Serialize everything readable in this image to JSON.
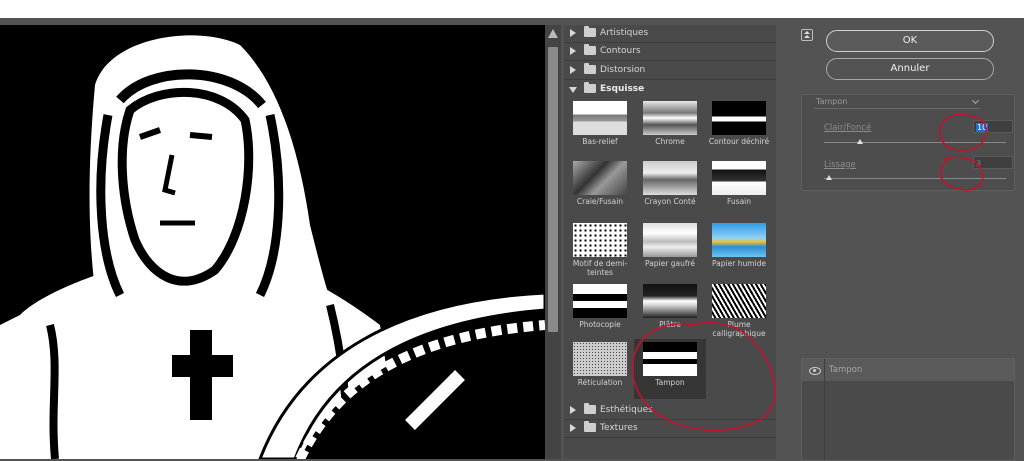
{
  "gallery": {
    "categories_top": [
      {
        "label": "Artistiques",
        "expanded": false
      },
      {
        "label": "Contours",
        "expanded": false
      },
      {
        "label": "Distorsion",
        "expanded": false
      },
      {
        "label": "Esquisse",
        "expanded": true
      }
    ],
    "filters": [
      {
        "label": "Bas-relief",
        "selected": false
      },
      {
        "label": "Chrome",
        "selected": false
      },
      {
        "label": "Contour déchiré",
        "selected": false
      },
      {
        "label": "Craie/Fusain",
        "selected": false
      },
      {
        "label": "Crayon Conté",
        "selected": false
      },
      {
        "label": "Fusain",
        "selected": false
      },
      {
        "label": "Motif de demi-teintes",
        "selected": false
      },
      {
        "label": "Papier gaufré",
        "selected": false
      },
      {
        "label": "Papier humide",
        "selected": false
      },
      {
        "label": "Photocopie",
        "selected": false
      },
      {
        "label": "Plâtre",
        "selected": false
      },
      {
        "label": "Plume calligraphique",
        "selected": false
      },
      {
        "label": "Réticulation",
        "selected": false
      },
      {
        "label": "Tampon",
        "selected": true
      }
    ],
    "categories_bottom": [
      {
        "label": "Esthétiques",
        "expanded": false
      },
      {
        "label": "Textures",
        "expanded": false
      }
    ]
  },
  "dialog": {
    "ok_label": "OK",
    "cancel_label": "Annuler",
    "filter_select": "Tampon",
    "params": [
      {
        "label": "Clair/Foncé",
        "value": "10",
        "level": 0.2
      },
      {
        "label": "Lissage",
        "value": "3",
        "level": 0.03
      }
    ],
    "layer_name": "Tampon"
  },
  "colors": {
    "annotation": "#c8102e",
    "highlight": "#1f6fd3"
  }
}
